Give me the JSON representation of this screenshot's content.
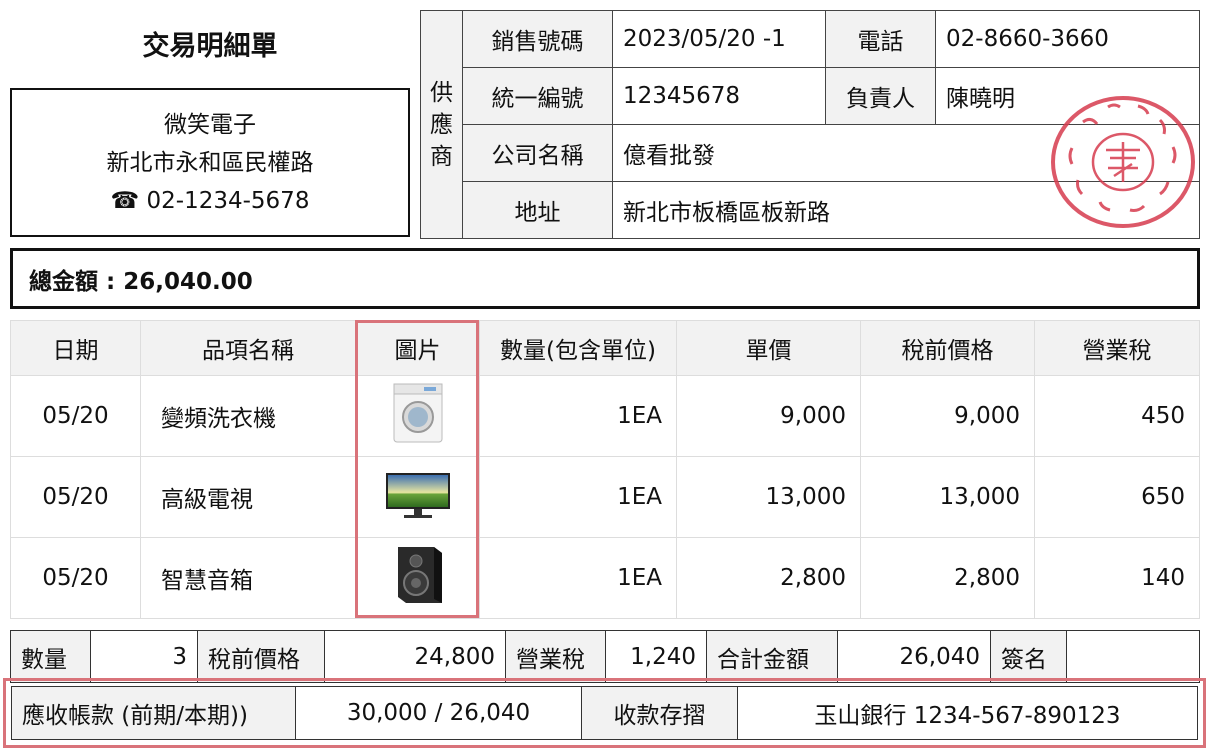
{
  "title": "交易明細單",
  "customer": {
    "name": "微笑電子",
    "address": "新北市永和區民權路",
    "phone": "02-1234-5678"
  },
  "supplier": {
    "side_label": [
      "供",
      "應",
      "商"
    ],
    "sales_no_label": "銷售號碼",
    "sales_no": "2023/05/20 -1",
    "phone_label": "電話",
    "phone": "02-8660-3660",
    "tax_id_label": "統一編號",
    "tax_id": "12345678",
    "owner_label": "負責人",
    "owner": "陳曉明",
    "company_label": "公司名稱",
    "company": "億看批發",
    "address_label": "地址",
    "address": "新北市板橋區板新路"
  },
  "total": "總金額 : 26,040.00",
  "items_table": {
    "headers": [
      "日期",
      "品項名稱",
      "圖片",
      "數量(包含單位)",
      "單價",
      "稅前價格",
      "營業稅"
    ],
    "rows": [
      {
        "date": "05/20",
        "name": "變頻洗衣機",
        "image": "washing-machine-icon",
        "qty": "1EA",
        "unit_price": "9,000",
        "pretax": "9,000",
        "tax": "450"
      },
      {
        "date": "05/20",
        "name": "高級電視",
        "image": "tv-icon",
        "qty": "1EA",
        "unit_price": "13,000",
        "pretax": "13,000",
        "tax": "650"
      },
      {
        "date": "05/20",
        "name": "智慧音箱",
        "image": "speaker-icon",
        "qty": "1EA",
        "unit_price": "2,800",
        "pretax": "2,800",
        "tax": "140"
      }
    ]
  },
  "summary": {
    "qty_label": "數量",
    "qty": "3",
    "pretax_label": "稅前價格",
    "pretax": "24,800",
    "tax_label": "營業稅",
    "tax": "1,240",
    "total_label": "合計金額",
    "total": "26,040",
    "sign_label": "簽名"
  },
  "receivable": {
    "label": "應收帳款 (前期/本期))",
    "value": "30,000 / 26,040",
    "deposit_label": "收款存摺",
    "deposit": "玉山銀行 1234-567-890123"
  },
  "colors": {
    "highlight": "#d9737a",
    "stamp": "#d63c4e",
    "header_bg": "#f2f2f2"
  }
}
